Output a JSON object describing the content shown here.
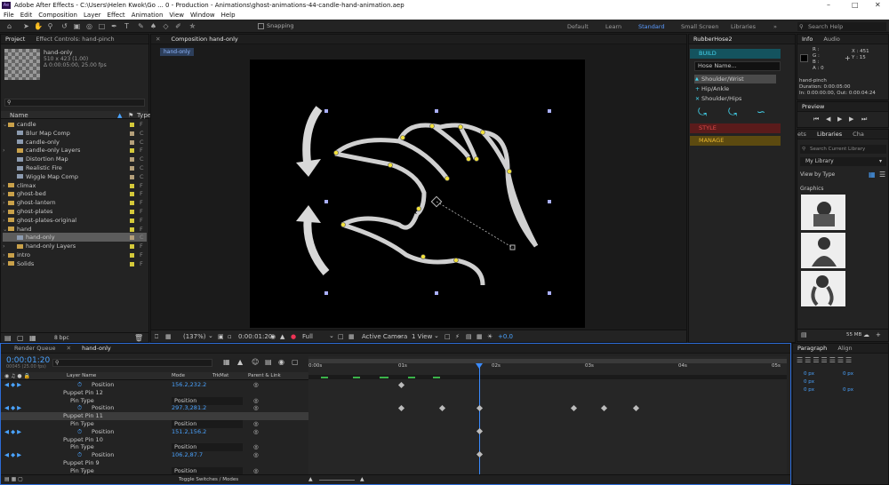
{
  "window": {
    "title": "Adobe After Effects - C:\\Users\\Helen Kwok\\Go ... 0 - Production - Animations\\ghost-animations-44-candle-hand-animation.aep",
    "logo": "Ae"
  },
  "menu": [
    "File",
    "Edit",
    "Composition",
    "Layer",
    "Effect",
    "Animation",
    "View",
    "Window",
    "Help"
  ],
  "toolbar": {
    "snapping": "Snapping",
    "workspaces": [
      "Default",
      "Learn",
      "Standard",
      "Small Screen",
      "Libraries"
    ],
    "active_workspace": "Standard",
    "search_placeholder": "Search Help"
  },
  "project": {
    "tabs": [
      "Project",
      "Effect Controls: hand-pinch"
    ],
    "item_name": "hand-only",
    "item_info1": "510 x 423 (1.00)",
    "item_info2": "Δ 0:00:05:00, 25.00 fps",
    "col_name": "Name",
    "col_type": "Type",
    "items": [
      {
        "name": "candle",
        "kind": "folder",
        "depth": 0,
        "expanded": true,
        "label": "#d4c93a",
        "type": "F"
      },
      {
        "name": "Blur Map Comp",
        "kind": "comp",
        "depth": 1,
        "label": "#b5a07a",
        "type": "C"
      },
      {
        "name": "candle-only",
        "kind": "comp",
        "depth": 1,
        "label": "#b5a07a",
        "type": "C"
      },
      {
        "name": "candle-only Layers",
        "kind": "folder",
        "depth": 1,
        "label": "#d4c93a",
        "type": "F"
      },
      {
        "name": "Distortion Map",
        "kind": "comp",
        "depth": 1,
        "label": "#b5a07a",
        "type": "C"
      },
      {
        "name": "Realistic Fire",
        "kind": "comp",
        "depth": 1,
        "label": "#b5a07a",
        "type": "C"
      },
      {
        "name": "Wiggle Map Comp",
        "kind": "comp",
        "depth": 1,
        "label": "#b5a07a",
        "type": "C"
      },
      {
        "name": "climax",
        "kind": "folder",
        "depth": 0,
        "label": "#d4c93a",
        "type": "F"
      },
      {
        "name": "ghost-bed",
        "kind": "folder",
        "depth": 0,
        "label": "#d4c93a",
        "type": "F"
      },
      {
        "name": "ghost-lantern",
        "kind": "folder",
        "depth": 0,
        "label": "#d4c93a",
        "type": "F"
      },
      {
        "name": "ghost-plates",
        "kind": "folder",
        "depth": 0,
        "label": "#d4c93a",
        "type": "F"
      },
      {
        "name": "ghost-plates-original",
        "kind": "folder",
        "depth": 0,
        "label": "#d4c93a",
        "type": "F"
      },
      {
        "name": "hand",
        "kind": "folder",
        "depth": 0,
        "expanded": true,
        "label": "#d4c93a",
        "type": "F"
      },
      {
        "name": "hand-only",
        "kind": "comp",
        "depth": 1,
        "selected": true,
        "label": "#b5a07a",
        "type": "C"
      },
      {
        "name": "hand-only Layers",
        "kind": "folder",
        "depth": 1,
        "label": "#d4c93a",
        "type": "F"
      },
      {
        "name": "intro",
        "kind": "folder",
        "depth": 0,
        "label": "#d4c93a",
        "type": "F"
      },
      {
        "name": "Solids",
        "kind": "folder",
        "depth": 0,
        "label": "#d4c93a",
        "type": "F"
      }
    ],
    "bpc": "8 bpc"
  },
  "composition": {
    "tab": "Composition hand-only",
    "flow_tab": "hand-only",
    "zoom": "(137%)",
    "timecode": "0:00:01:20",
    "resolution": "Full",
    "camera": "Active Camera",
    "views": "1 View",
    "exposure": "+0.0"
  },
  "rubberhose": {
    "tab": "RubberHose2",
    "build": "BUILD",
    "hose_name": "Hose Name...",
    "options": [
      "Shoulder/Wrist",
      "Hip/Ankle",
      "Shoulder/Hips"
    ],
    "style": "STYLE",
    "manage": "MANAGE"
  },
  "info": {
    "tabs": [
      "Info",
      "Audio"
    ],
    "r": "R :",
    "g": "G :",
    "b": "B :",
    "a": "A : 0",
    "x": "X : 451",
    "y": "Y : 15",
    "layer": "hand-pinch",
    "duration": "Duration: 0:00:05:00",
    "inout": "In: 0:00:00:00, Out: 0:00:04:24"
  },
  "preview": {
    "tab": "Preview"
  },
  "libraries": {
    "tabs": [
      "ets",
      "Libraries",
      "Cha"
    ],
    "search_placeholder": "Search Current Library",
    "library": "My Library",
    "view_by": "View by Type",
    "section": "Graphics",
    "size": "55 MB"
  },
  "paragraph": {
    "tabs": [
      "Paragraph",
      "Align"
    ],
    "px": [
      "0 px",
      "0 px",
      "0 px",
      "0 px",
      "0 px"
    ]
  },
  "timeline": {
    "tabs": [
      "Render Queue",
      "hand-only"
    ],
    "timecode": "0:00:01:20",
    "fps_sub": "00045 (25.00 fps)",
    "col_layer": "Layer Name",
    "col_mode": "Mode",
    "col_trkmat": "TrkMat",
    "col_parent": "Parent & Link",
    "ruler": [
      "0:00s",
      "01s",
      "02s",
      "03s",
      "04s",
      "05s"
    ],
    "toggle": "Toggle Switches / Modes",
    "rows": [
      {
        "indent": 3,
        "text": "Position",
        "value": "156.2,232.2"
      },
      {
        "indent": 1,
        "text": "Puppet Pin 12"
      },
      {
        "indent": 2,
        "text": "Pin Type",
        "mode": "Position"
      },
      {
        "indent": 3,
        "text": "Position",
        "value": "297.3,281.2"
      },
      {
        "indent": 1,
        "text": "Puppet Pin 11",
        "selected": true
      },
      {
        "indent": 2,
        "text": "Pin Type",
        "mode": "Position"
      },
      {
        "indent": 3,
        "text": "Position",
        "value": "151.2,156.2"
      },
      {
        "indent": 1,
        "text": "Puppet Pin 10"
      },
      {
        "indent": 2,
        "text": "Pin Type",
        "mode": "Position"
      },
      {
        "indent": 3,
        "text": "Position",
        "value": "106.2,87.7"
      },
      {
        "indent": 1,
        "text": "Puppet Pin 9"
      },
      {
        "indent": 2,
        "text": "Pin Type",
        "mode": "Position"
      }
    ]
  }
}
